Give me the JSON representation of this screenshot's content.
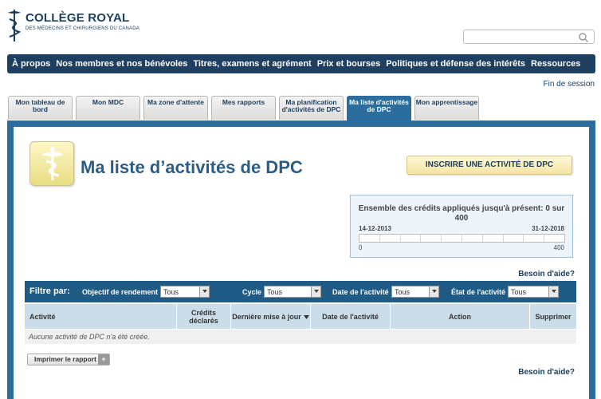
{
  "header": {
    "logo_name": "COLLÈGE ROYAL",
    "logo_sub": "DES MÉDECINS ET CHIRURGIENS DU CANADA",
    "search_placeholder": ""
  },
  "nav": [
    "À propos",
    "Nos membres et nos bénévoles",
    "Titres, examens et agrément",
    "Prix et bourses",
    "Politiques et défense des intérêts",
    "Ressources"
  ],
  "logout": "Fin de session",
  "tabs": [
    {
      "label": "Mon tableau de bord",
      "active": false
    },
    {
      "label": "Mon MDC",
      "active": false
    },
    {
      "label": "Ma zone d'attente",
      "active": false
    },
    {
      "label": "Mes rapports",
      "active": false
    },
    {
      "label": "Ma planification d'activités de DPC",
      "active": false
    },
    {
      "label": "Ma liste d'activités de DPC",
      "active": true
    },
    {
      "label": "Mon apprentissage",
      "active": false
    }
  ],
  "page": {
    "title": "Ma liste d’activités de DPC",
    "cta": "INSCRIRE UNE ACTIVITÉ DE DPC",
    "help": "Besoin d'aide?"
  },
  "credits": {
    "title": "Ensemble des crédits appliqués jusqu'à présent: 0 sur",
    "total": "400",
    "date_start": "14-12-2013",
    "date_end": "31-12-2018",
    "min": "0",
    "max": "400",
    "progress_fraction": 0
  },
  "filter": {
    "label": "Filtre par:",
    "objective_label": "Objectif de rendement",
    "objective_value": "Tous",
    "cycle_label": "Cycle",
    "cycle_value": "Tous",
    "date_label": "Date de l'activité",
    "date_value": "Tous",
    "state_label": "État de l'activité",
    "state_value": "Tous"
  },
  "table": {
    "headers": [
      "Activité",
      "Crédits déclarés",
      "Dernière mise à jour",
      "Date de l'activité",
      "Action",
      "Supprimer"
    ],
    "empty": "Aucune activité de DPC n'a été créée."
  },
  "print_label": "Imprimer le rapport",
  "colors": {
    "nav": "#1f3f60",
    "accent": "#2b6d9c",
    "cta_bg": "#f5e4a5"
  }
}
